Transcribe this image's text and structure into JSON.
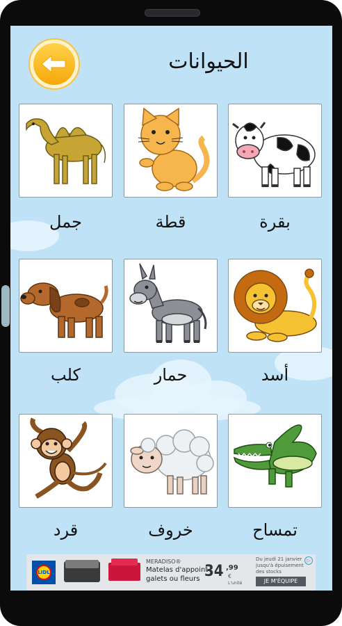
{
  "header": {
    "title": "الحيوانات",
    "back_icon": "arrow-left-icon"
  },
  "animals": [
    {
      "id": "camel",
      "label": "جمل"
    },
    {
      "id": "cat",
      "label": "قطة"
    },
    {
      "id": "cow",
      "label": "بقرة"
    },
    {
      "id": "dog",
      "label": "كلب"
    },
    {
      "id": "donkey",
      "label": "حمار"
    },
    {
      "id": "lion",
      "label": "أسد"
    },
    {
      "id": "monkey",
      "label": "قرد"
    },
    {
      "id": "sheep",
      "label": "خروف"
    },
    {
      "id": "crocodile",
      "label": "تمساح"
    }
  ],
  "ad": {
    "logo_text": "LIDL",
    "brand": "MERADISO®",
    "line1": "Matelas d'appoint",
    "line2": "galets ou fleurs",
    "price": "34",
    "price_dec": ",99",
    "price_unit": "€",
    "price_note": "L'unité",
    "date_line1": "Du jeudi 21 janvier",
    "date_line2": "jusqu'à épuisement",
    "date_line3": "des stocks",
    "cta": "JE M'ÉQUIPE",
    "info_icon": "ad-choices-icon"
  },
  "colors": {
    "background": "#bfe2f6",
    "back_button": "#f5a80a"
  }
}
